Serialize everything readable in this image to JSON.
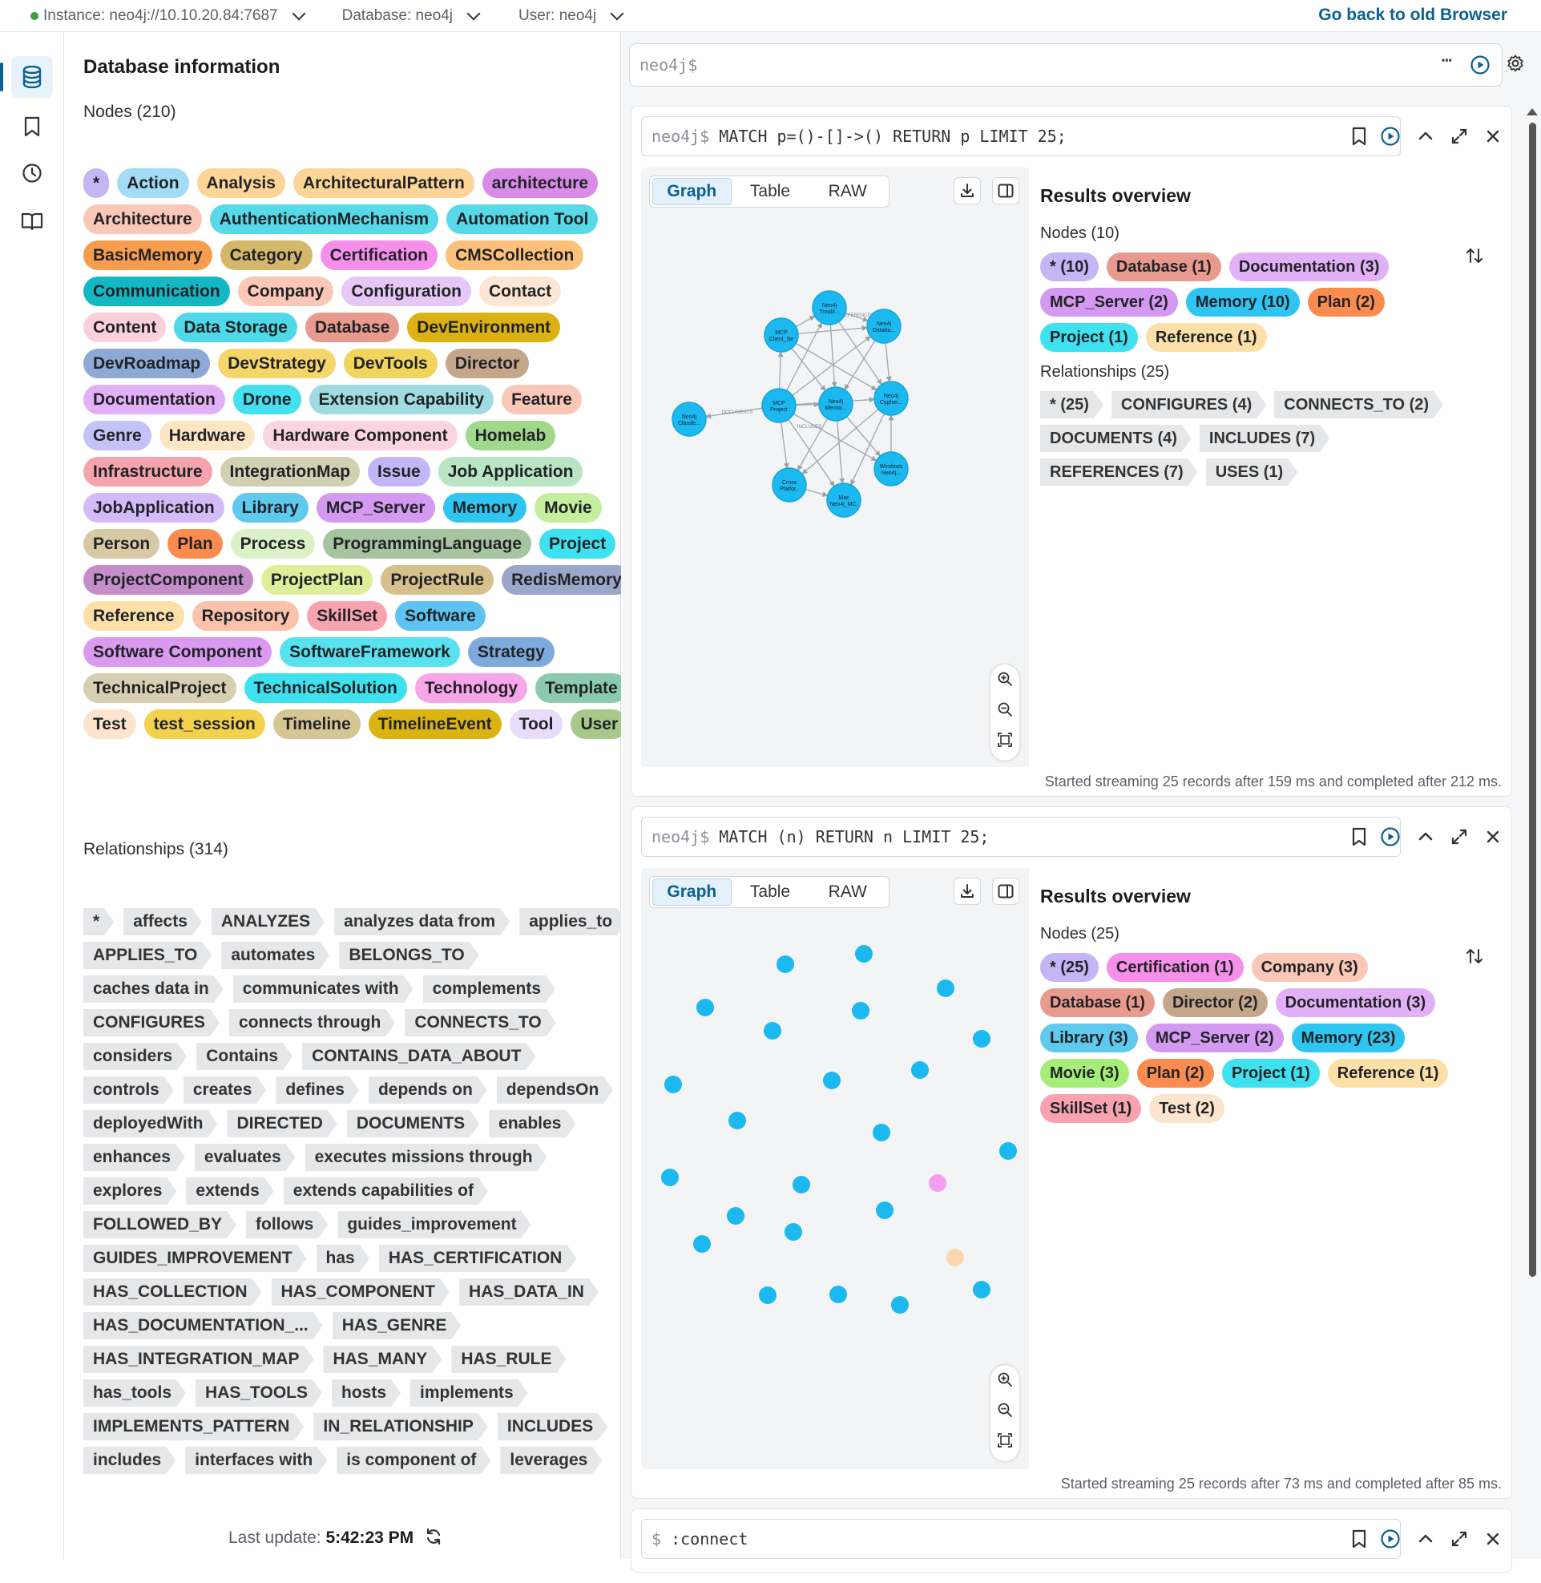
{
  "topbar": {
    "instance": "Instance: neo4j://10.10.20.84:7687",
    "database": "Database: neo4j",
    "user": "User: neo4j",
    "go_back": "Go back to old Browser"
  },
  "sidebar": {
    "title": "Database information",
    "nodes_label": "Nodes (210)",
    "node_tags": [
      {
        "label": "*",
        "color": "#c4b5f4"
      },
      {
        "label": "Action",
        "color": "#a3dcf5"
      },
      {
        "label": "Analysis",
        "color": "#fdd597"
      },
      {
        "label": "ArchitecturalPattern",
        "color": "#fdd597"
      },
      {
        "label": "architecture",
        "color": "#d98be8"
      },
      {
        "label": "Architecture",
        "color": "#fbc7b6"
      },
      {
        "label": "AuthenticationMechanism",
        "color": "#57d9e8"
      },
      {
        "label": "Automation Tool",
        "color": "#57d9e8"
      },
      {
        "label": "BasicMemory",
        "color": "#f79d4e"
      },
      {
        "label": "Category",
        "color": "#d4b86a"
      },
      {
        "label": "Certification",
        "color": "#f58fe9"
      },
      {
        "label": "CMSCollection",
        "color": "#fdc07a"
      },
      {
        "label": "Communication",
        "color": "#14b8c4"
      },
      {
        "label": "Company",
        "color": "#fbc7b6"
      },
      {
        "label": "Configuration",
        "color": "#e6c7f5"
      },
      {
        "label": "Contact",
        "color": "#fde6d3"
      },
      {
        "label": "Content",
        "color": "#fad0dc"
      },
      {
        "label": "Data Storage",
        "color": "#4fd8e8"
      },
      {
        "label": "Database",
        "color": "#e79a8d"
      },
      {
        "label": "DevEnvironment",
        "color": "#dbb114"
      },
      {
        "label": "DevRoadmap",
        "color": "#8ea9d6"
      },
      {
        "label": "DevStrategy",
        "color": "#f5d66b"
      },
      {
        "label": "DevTools",
        "color": "#f0d45c"
      },
      {
        "label": "Director",
        "color": "#c4a78a"
      },
      {
        "label": "Documentation",
        "color": "#e2b0f7"
      },
      {
        "label": "Drone",
        "color": "#44e0ef"
      },
      {
        "label": "Extension Capability",
        "color": "#9fdbe0"
      },
      {
        "label": "Feature",
        "color": "#fbc7b6"
      },
      {
        "label": "Genre",
        "color": "#c3c3f8"
      },
      {
        "label": "Hardware",
        "color": "#fde6c4"
      },
      {
        "label": "Hardware Component",
        "color": "#fbd4e2"
      },
      {
        "label": "Homelab",
        "color": "#a0d88c"
      },
      {
        "label": "Infrastructure",
        "color": "#f5a3ad"
      },
      {
        "label": "IntegrationMap",
        "color": "#d2d0b3"
      },
      {
        "label": "Issue",
        "color": "#c2b6f6"
      },
      {
        "label": "Job Application",
        "color": "#b9e5c5"
      },
      {
        "label": "JobApplication",
        "color": "#d2bbf7"
      },
      {
        "label": "Library",
        "color": "#5fc9ee"
      },
      {
        "label": "MCP_Server",
        "color": "#d49af2"
      },
      {
        "label": "Memory",
        "color": "#2ec5f0"
      },
      {
        "label": "Movie",
        "color": "#c5ef9e"
      },
      {
        "label": "Person",
        "color": "#d8c9a6"
      },
      {
        "label": "Plan",
        "color": "#fb8c4f"
      },
      {
        "label": "Process",
        "color": "#dcf1c8"
      },
      {
        "label": "ProgrammingLanguage",
        "color": "#a7c4a0"
      },
      {
        "label": "Project",
        "color": "#3ee1f0"
      },
      {
        "label": "ProjectComponent",
        "color": "#c58ecb"
      },
      {
        "label": "ProjectPlan",
        "color": "#dfee9a"
      },
      {
        "label": "ProjectRule",
        "color": "#d6c08c"
      },
      {
        "label": "RedisMemory",
        "color": "#9ba7c9"
      },
      {
        "label": "Reference",
        "color": "#fde0a8"
      },
      {
        "label": "Repository",
        "color": "#fcc1ab"
      },
      {
        "label": "SkillSet",
        "color": "#f9a3b0"
      },
      {
        "label": "Software",
        "color": "#5ec3f1"
      },
      {
        "label": "Software Component",
        "color": "#da9af2"
      },
      {
        "label": "SoftwareFramework",
        "color": "#58e2ef"
      },
      {
        "label": "Strategy",
        "color": "#7ea9dc"
      },
      {
        "label": "TechnicalProject",
        "color": "#d6cfb1"
      },
      {
        "label": "TechnicalSolution",
        "color": "#3ee2ef"
      },
      {
        "label": "Technology",
        "color": "#f7a7e9"
      },
      {
        "label": "Template",
        "color": "#8ccab0"
      },
      {
        "label": "Test",
        "color": "#fde4cf"
      },
      {
        "label": "test_session",
        "color": "#f3d14d"
      },
      {
        "label": "Timeline",
        "color": "#d6c693"
      },
      {
        "label": "TimelineEvent",
        "color": "#dcb412"
      },
      {
        "label": "Tool",
        "color": "#e9dcfb"
      },
      {
        "label": "User",
        "color": "#a8c98a"
      }
    ],
    "rels_label": "Relationships (314)",
    "rel_tags": [
      "*",
      "affects",
      "ANALYZES",
      "analyzes data from",
      "applies_to",
      "APPLIES_TO",
      "automates",
      "BELONGS_TO",
      "caches data in",
      "communicates with",
      "complements",
      "CONFIGURES",
      "connects through",
      "CONNECTS_TO",
      "considers",
      "Contains",
      "CONTAINS_DATA_ABOUT",
      "controls",
      "creates",
      "defines",
      "depends on",
      "dependsOn",
      "deployedWith",
      "DIRECTED",
      "DOCUMENTS",
      "enables",
      "enhances",
      "evaluates",
      "executes missions through",
      "explores",
      "extends",
      "extends capabilities of",
      "FOLLOWED_BY",
      "follows",
      "guides_improvement",
      "GUIDES_IMPROVEMENT",
      "has",
      "HAS_CERTIFICATION",
      "HAS_COLLECTION",
      "HAS_COMPONENT",
      "HAS_DATA_IN",
      "HAS_DOCUMENTATION_...",
      "HAS_GENRE",
      "HAS_INTEGRATION_MAP",
      "HAS_MANY",
      "HAS_RULE",
      "has_tools",
      "HAS_TOOLS",
      "hosts",
      "implements",
      "IMPLEMENTS_PATTERN",
      "IN_RELATIONSHIP",
      "INCLUDES",
      "includes",
      "interfaces with",
      "is component of",
      "leverages"
    ],
    "last_update_label": "Last update:",
    "last_update_time": "5:42:23 PM"
  },
  "editor": {
    "placeholder": "neo4j$"
  },
  "frames": [
    {
      "prompt": "neo4j$",
      "query": "MATCH p=()-[]->() RETURN p LIMIT 25;",
      "tabs": [
        "Graph",
        "Table",
        "RAW"
      ],
      "overview_title": "Results overview",
      "nodes_label": "Nodes (10)",
      "node_tags": [
        {
          "label": "* (10)",
          "color": "#c4b5f4"
        },
        {
          "label": "Database (1)",
          "color": "#e79a8d"
        },
        {
          "label": "Documentation (3)",
          "color": "#e2b0f7"
        },
        {
          "label": "MCP_Server (2)",
          "color": "#d49af2"
        },
        {
          "label": "Memory (10)",
          "color": "#2ec5f0"
        },
        {
          "label": "Plan (2)",
          "color": "#fb8c4f"
        },
        {
          "label": "Project (1)",
          "color": "#3ee1f0"
        },
        {
          "label": "Reference (1)",
          "color": "#fde0a8"
        }
      ],
      "rels_label": "Relationships (25)",
      "rel_tags": [
        "* (25)",
        "CONFIGURES (4)",
        "CONNECTS_TO (2)",
        "DOCUMENTS (4)",
        "INCLUDES (7)",
        "REFERENCES (7)",
        "USES (1)"
      ],
      "graph_nodes": [
        "Neo4j_Troubl...",
        "Neo4j_Databa...",
        "MCP_Client_Set...",
        "MCP_Project",
        "Neo4j_Memor...",
        "Neo4j_Cypher...",
        "Neo4j_Claude...",
        "Cross_Platfor...",
        "Mac_Neo4j_MC...",
        "Windows_Neo4j..."
      ],
      "edge_labels": [
        "DOCUMENTS",
        "REFERENCES",
        "INCLUDES"
      ],
      "footer": "Started streaming 25 records after 159 ms and completed after 212 ms."
    },
    {
      "prompt": "neo4j$",
      "query": "MATCH (n) RETURN n LIMIT 25;",
      "tabs": [
        "Graph",
        "Table",
        "RAW"
      ],
      "overview_title": "Results overview",
      "nodes_label": "Nodes (25)",
      "node_tags": [
        {
          "label": "* (25)",
          "color": "#c4b5f4"
        },
        {
          "label": "Certification (1)",
          "color": "#f58fe9"
        },
        {
          "label": "Company (3)",
          "color": "#fbc7b6"
        },
        {
          "label": "Database (1)",
          "color": "#e79a8d"
        },
        {
          "label": "Director (2)",
          "color": "#c4a78a"
        },
        {
          "label": "Documentation (3)",
          "color": "#e2b0f7"
        },
        {
          "label": "Library (3)",
          "color": "#5fc9ee"
        },
        {
          "label": "MCP_Server (2)",
          "color": "#d49af2"
        },
        {
          "label": "Memory (23)",
          "color": "#2ec5f0"
        },
        {
          "label": "Movie (3)",
          "color": "#a5ee77"
        },
        {
          "label": "Plan (2)",
          "color": "#fb8c4f"
        },
        {
          "label": "Project (1)",
          "color": "#3ee1f0"
        },
        {
          "label": "Reference (1)",
          "color": "#fde0a8"
        },
        {
          "label": "SkillSet (1)",
          "color": "#f9a3b0"
        },
        {
          "label": "Test (2)",
          "color": "#fde4cf"
        }
      ],
      "footer": "Started streaming 25 records after 73 ms and completed after 85 ms."
    },
    {
      "prompt": "$",
      "query": ":connect"
    }
  ],
  "colors": {
    "accent": "#0a6190",
    "node_blue": "#1cb8f0",
    "node_pink": "#f59df0",
    "node_peach": "#fcd6b0"
  }
}
